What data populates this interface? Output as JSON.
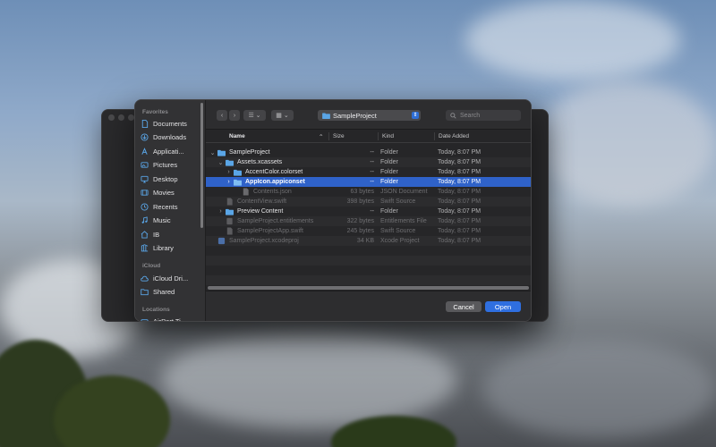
{
  "sidebar": {
    "favorites_label": "Favorites",
    "favorites": [
      {
        "label": "Documents",
        "icon": "document-icon"
      },
      {
        "label": "Downloads",
        "icon": "download-icon"
      },
      {
        "label": "Applicati...",
        "icon": "applications-icon"
      },
      {
        "label": "Pictures",
        "icon": "pictures-icon"
      },
      {
        "label": "Desktop",
        "icon": "desktop-icon"
      },
      {
        "label": "Movies",
        "icon": "movies-icon"
      },
      {
        "label": "Recents",
        "icon": "clock-icon"
      },
      {
        "label": "Music",
        "icon": "music-icon"
      },
      {
        "label": "IB",
        "icon": "home-icon"
      },
      {
        "label": "Library",
        "icon": "library-icon"
      }
    ],
    "icloud_label": "iCloud",
    "icloud": [
      {
        "label": "iCloud Dri...",
        "icon": "cloud-icon"
      },
      {
        "label": "Shared",
        "icon": "shared-folder-icon"
      }
    ],
    "locations_label": "Locations",
    "locations": [
      {
        "label": "AirPort Ti...",
        "icon": "disk-icon"
      }
    ]
  },
  "toolbar": {
    "path": "SampleProject",
    "search_placeholder": "Search"
  },
  "columns": {
    "name": "Name",
    "size": "Size",
    "kind": "Kind",
    "date": "Date Added"
  },
  "files": [
    {
      "name": "SampleProject",
      "size": "--",
      "kind": "Folder",
      "date": "Today, 8:07 PM"
    },
    {
      "name": "Assets.xcassets",
      "size": "--",
      "kind": "Folder",
      "date": "Today, 8:07 PM"
    },
    {
      "name": "AccentColor.colorset",
      "size": "--",
      "kind": "Folder",
      "date": "Today, 8:07 PM"
    },
    {
      "name": "AppIcon.appiconset",
      "size": "--",
      "kind": "Folder",
      "date": "Today, 8:07 PM"
    },
    {
      "name": "Contents.json",
      "size": "63 bytes",
      "kind": "JSON Document",
      "date": "Today, 8:07 PM"
    },
    {
      "name": "ContentView.swift",
      "size": "398 bytes",
      "kind": "Swift Source",
      "date": "Today, 8:07 PM"
    },
    {
      "name": "Preview Content",
      "size": "--",
      "kind": "Folder",
      "date": "Today, 8:07 PM"
    },
    {
      "name": "SampleProject.entitlements",
      "size": "322 bytes",
      "kind": "Entitlements File",
      "date": "Today, 8:07 PM"
    },
    {
      "name": "SampleProjectApp.swift",
      "size": "245 bytes",
      "kind": "Swift Source",
      "date": "Today, 8:07 PM"
    },
    {
      "name": "SampleProject.xcodeproj",
      "size": "34 KB",
      "kind": "Xcode Project",
      "date": "Today, 8:07 PM"
    }
  ],
  "buttons": {
    "cancel": "Cancel",
    "open": "Open"
  },
  "colors": {
    "accent": "#2f6fe0",
    "selection": "#2f62c9",
    "folder": "#5aa5e6"
  }
}
